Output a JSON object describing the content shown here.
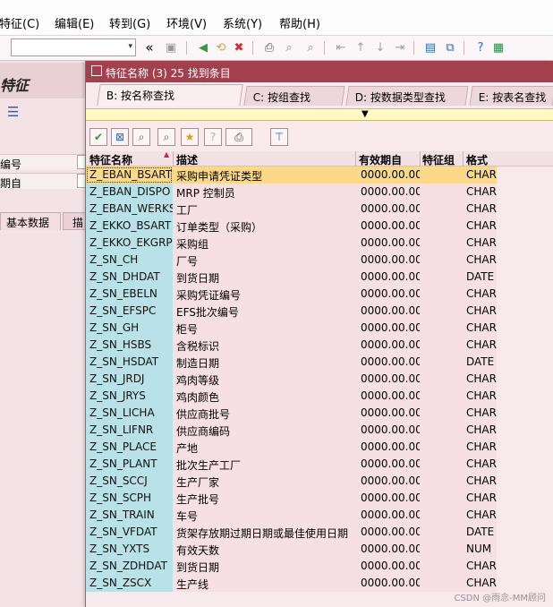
{
  "menu": [
    "特征(C)",
    "编辑(E)",
    "转到(G)",
    "环境(V)",
    "系统(Y)",
    "帮助(H)"
  ],
  "toolbar": {
    "command_value": "",
    "dropdown_glyph": "▾",
    "nav_glyph": "«",
    "icons": [
      {
        "name": "save-icon",
        "glyph": "▣",
        "color": "#9a9a9a"
      },
      {
        "name": "back-icon",
        "glyph": "◀",
        "color": "#3c9a3c"
      },
      {
        "name": "exit-icon",
        "glyph": "⟲",
        "color": "#e0a020"
      },
      {
        "name": "cancel-icon",
        "glyph": "✖",
        "color": "#d03030"
      },
      {
        "name": "print-icon",
        "glyph": "⎙",
        "color": "#555555"
      },
      {
        "name": "find-icon",
        "glyph": "⌕",
        "color": "#8a8a8a"
      },
      {
        "name": "find-next-icon",
        "glyph": "⌕",
        "color": "#8a8a8a"
      },
      {
        "name": "first-page-icon",
        "glyph": "⇤",
        "color": "#a0a0a0"
      },
      {
        "name": "prev-page-icon",
        "glyph": "↑",
        "color": "#a0a0a0"
      },
      {
        "name": "next-page-icon",
        "glyph": "↓",
        "color": "#a0a0a0"
      },
      {
        "name": "last-page-icon",
        "glyph": "⇥",
        "color": "#a0a0a0"
      },
      {
        "name": "create-session-icon",
        "glyph": "▤",
        "color": "#2a6ab8"
      },
      {
        "name": "shortcut-icon",
        "glyph": "⧉",
        "color": "#2a6ab8"
      },
      {
        "name": "help-icon",
        "glyph": "?",
        "color": "#2a6ab8"
      },
      {
        "name": "layout-icon",
        "glyph": "▦",
        "color": "#2a8a4a"
      }
    ]
  },
  "background": {
    "title": "特征",
    "fields": [
      "编号",
      "期自"
    ],
    "tabs": [
      "基本数据",
      "描"
    ]
  },
  "popup": {
    "title": "特征名称 (3)   25 找到条目",
    "tabs": [
      "B: 按名称查找",
      "C: 按组查找",
      "D: 按数据类型查找",
      "E: 按表名查找"
    ],
    "toolbar_icons": [
      {
        "name": "confirm-icon",
        "glyph": "✔",
        "color": "#2e9a2e"
      },
      {
        "name": "cancel-icon",
        "glyph": "⊠",
        "color": "#2a6ab8"
      },
      {
        "name": "find-icon",
        "glyph": "⌕",
        "color": "#555555"
      },
      {
        "name": "find-next-icon",
        "glyph": "⌕",
        "color": "#555555"
      },
      {
        "name": "favorite-add-icon",
        "glyph": "★",
        "color": "#d8a010"
      },
      {
        "name": "info-icon",
        "glyph": "?",
        "color": "#b0b0b0"
      },
      {
        "name": "print-icon",
        "glyph": "⎙",
        "color": "#444444"
      },
      {
        "name": "filter-icon",
        "glyph": "⊤",
        "color": "#2a6ab8"
      }
    ],
    "columns": [
      "特征名称",
      "描述",
      "有效期自",
      "特征组",
      "格式"
    ],
    "rows": [
      {
        "name": "Z_EBAN_BSART",
        "desc": "采购申请凭证类型",
        "date": "0000.00.00",
        "group": "",
        "format": "CHAR"
      },
      {
        "name": "Z_EBAN_DISPO",
        "desc": "MRP 控制员",
        "date": "0000.00.00",
        "group": "",
        "format": "CHAR"
      },
      {
        "name": "Z_EBAN_WERKS",
        "desc": "工厂",
        "date": "0000.00.00",
        "group": "",
        "format": "CHAR"
      },
      {
        "name": "Z_EKKO_BSART",
        "desc": "订单类型（采购）",
        "date": "0000.00.00",
        "group": "",
        "format": "CHAR"
      },
      {
        "name": "Z_EKKO_EKGRP",
        "desc": "采购组",
        "date": "0000.00.00",
        "group": "",
        "format": "CHAR"
      },
      {
        "name": "Z_SN_CH",
        "desc": "厂号",
        "date": "0000.00.00",
        "group": "",
        "format": "CHAR"
      },
      {
        "name": "Z_SN_DHDAT",
        "desc": "到货日期",
        "date": "0000.00.00",
        "group": "",
        "format": "DATE"
      },
      {
        "name": "Z_SN_EBELN",
        "desc": "采购凭证编号",
        "date": "0000.00.00",
        "group": "",
        "format": "CHAR"
      },
      {
        "name": "Z_SN_EFSPC",
        "desc": "EFS批次编号",
        "date": "0000.00.00",
        "group": "",
        "format": "CHAR"
      },
      {
        "name": "Z_SN_GH",
        "desc": "柜号",
        "date": "0000.00.00",
        "group": "",
        "format": "CHAR"
      },
      {
        "name": "Z_SN_HSBS",
        "desc": "含税标识",
        "date": "0000.00.00",
        "group": "",
        "format": "CHAR"
      },
      {
        "name": "Z_SN_HSDAT",
        "desc": "制造日期",
        "date": "0000.00.00",
        "group": "",
        "format": "DATE"
      },
      {
        "name": "Z_SN_JRDJ",
        "desc": "鸡肉等级",
        "date": "0000.00.00",
        "group": "",
        "format": "CHAR"
      },
      {
        "name": "Z_SN_JRYS",
        "desc": "鸡肉颜色",
        "date": "0000.00.00",
        "group": "",
        "format": "CHAR"
      },
      {
        "name": "Z_SN_LICHA",
        "desc": "供应商批号",
        "date": "0000.00.00",
        "group": "",
        "format": "CHAR"
      },
      {
        "name": "Z_SN_LIFNR",
        "desc": "供应商编码",
        "date": "0000.00.00",
        "group": "",
        "format": "CHAR"
      },
      {
        "name": "Z_SN_PLACE",
        "desc": "产地",
        "date": "0000.00.00",
        "group": "",
        "format": "CHAR"
      },
      {
        "name": "Z_SN_PLANT",
        "desc": "批次生产工厂",
        "date": "0000.00.00",
        "group": "",
        "format": "CHAR"
      },
      {
        "name": "Z_SN_SCCJ",
        "desc": "生产厂家",
        "date": "0000.00.00",
        "group": "",
        "format": "CHAR"
      },
      {
        "name": "Z_SN_SCPH",
        "desc": "生产批号",
        "date": "0000.00.00",
        "group": "",
        "format": "CHAR"
      },
      {
        "name": "Z_SN_TRAIN",
        "desc": "车号",
        "date": "0000.00.00",
        "group": "",
        "format": "CHAR"
      },
      {
        "name": "Z_SN_VFDAT",
        "desc": "货架存放期过期日期或最佳使用日期",
        "date": "0000.00.00",
        "group": "",
        "format": "DATE"
      },
      {
        "name": "Z_SN_YXTS",
        "desc": "有效天数",
        "date": "0000.00.00",
        "group": "",
        "format": "NUM"
      },
      {
        "name": "Z_SN_ZDHDAT",
        "desc": "到货日期",
        "date": "0000.00.00",
        "group": "",
        "format": "CHAR"
      },
      {
        "name": "Z_SN_ZSCX",
        "desc": "生产线",
        "date": "0000.00.00",
        "group": "",
        "format": "CHAR"
      }
    ],
    "selected_index": 0
  },
  "watermark": "CSDN @雨念-MM顾问",
  "colors": {
    "titlebar": "#a3404e",
    "key_column": "#b9e1e8",
    "selected_row": "#fbd98a",
    "info_bar": "#fff8c4"
  }
}
